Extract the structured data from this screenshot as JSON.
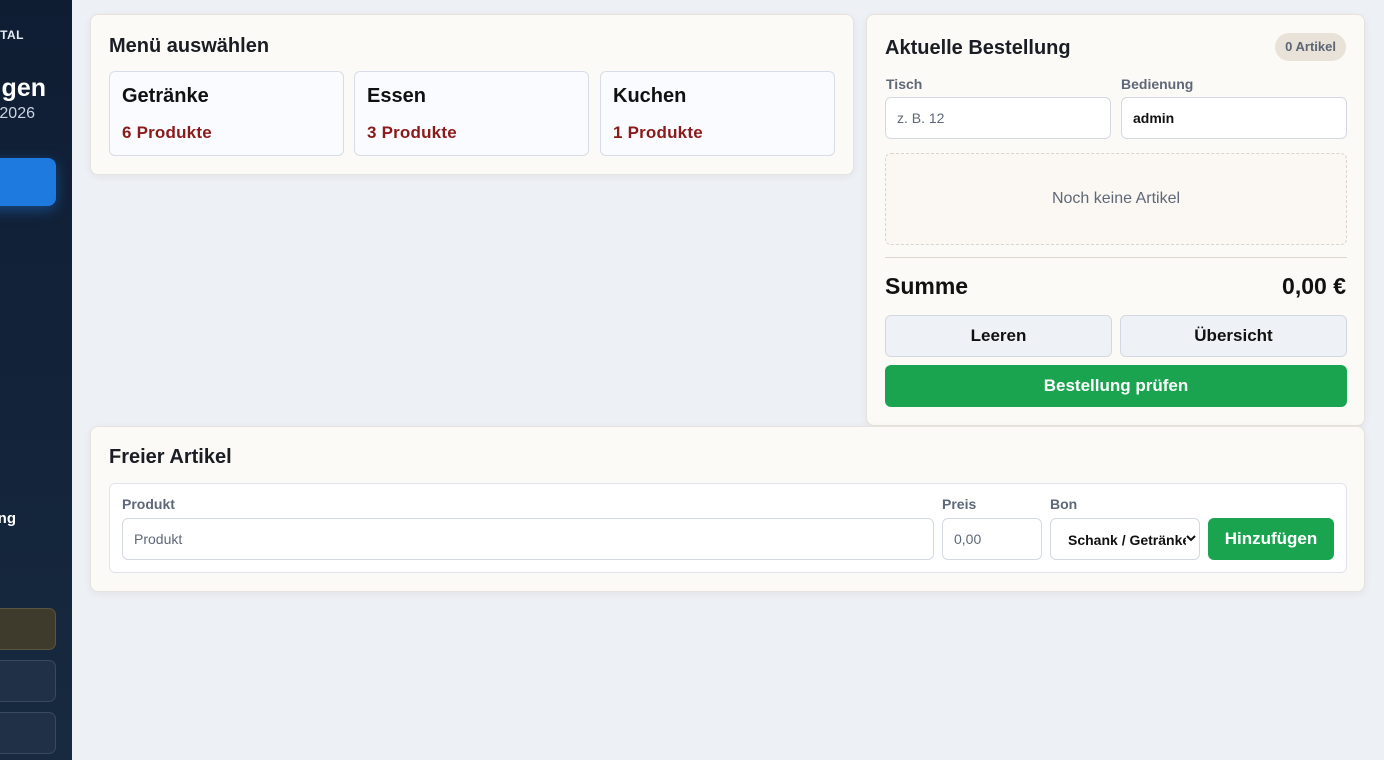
{
  "sidebar": {
    "brand": "TAL",
    "title": "gen",
    "subtitle": "2026",
    "nav_label": "ng"
  },
  "menu": {
    "title": "Menü auswählen",
    "categories": [
      {
        "name": "Getränke",
        "count": "6 Produkte"
      },
      {
        "name": "Essen",
        "count": "3 Produkte"
      },
      {
        "name": "Kuchen",
        "count": "1 Produkte"
      }
    ]
  },
  "order": {
    "title": "Aktuelle Bestellung",
    "badge": "0 Artikel",
    "table_label": "Tisch",
    "table_placeholder": "z. B. 12",
    "table_value": "",
    "server_label": "Bedienung",
    "server_value": "admin",
    "empty_text": "Noch keine Artikel",
    "sum_label": "Summe",
    "sum_value": "0,00 €",
    "clear_label": "Leeren",
    "overview_label": "Übersicht",
    "check_label": "Bestellung prüfen"
  },
  "free_item": {
    "title": "Freier Artikel",
    "product_label": "Produkt",
    "product_placeholder": "Produkt",
    "price_label": "Preis",
    "price_placeholder": "0,00",
    "bon_label": "Bon",
    "bon_value": "Schank / Getränke",
    "add_label": "Hinzufügen"
  },
  "colors": {
    "accent_green": "#1aa44f",
    "accent_blue": "#1f7ae0",
    "product_count": "#8b1a1a",
    "sidebar_bg": "#0f1d33"
  }
}
